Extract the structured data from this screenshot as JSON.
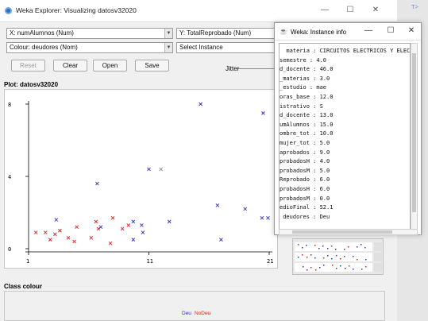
{
  "main_window": {
    "title": "Weka Explorer: Visualizing datosv32020",
    "minimize": "—",
    "maximize": "☐",
    "close": "✕"
  },
  "controls": {
    "x_axis": "X: numAlumnos (Num)",
    "y_axis": "Y: TotalReprobado (Num)",
    "colour": "Colour: deudores (Nom)",
    "select_instance": "Select Instance",
    "reset": "Reset",
    "clear": "Clear",
    "open": "Open",
    "save": "Save",
    "jitter": "Jitter"
  },
  "plot": {
    "label": "Plot: datosv32020",
    "y_ticks": [
      "8",
      "4",
      "0"
    ],
    "x_ticks": [
      "1",
      "11",
      "21"
    ]
  },
  "class_colour": {
    "label": "Class colour",
    "deu": "Deu",
    "nodeu": "NoDeu"
  },
  "colors": {
    "deu": "#3333cc",
    "nodeu": "#dd2222"
  },
  "right_stub": {
    "text": "T>"
  },
  "instance_info": {
    "title": "Weka: Instance info",
    "lines": [
      "  materia : CIRCUITOS ELECTRICOS Y ELECTRO",
      "semestre : 4.0",
      "d_docente : 46.0",
      "_materias : 3.0",
      "_estudio : mae",
      "oras_base : 12.0",
      "istrativo : S",
      "d_docente : 13.0",
      "umAlumnos : 15.0",
      "ombre_tot : 10.0",
      "mujer_tot : 5.0",
      "aprobados : 9.0",
      "probadosH : 4.0",
      "probadosM : 5.0",
      "Reprobado : 6.0",
      "probadosH : 6.0",
      "probadosM : 0.0",
      "edioFinal : 52.1",
      " deudores : Deu"
    ]
  },
  "chart_data": {
    "type": "scatter",
    "title": "",
    "xlabel": "numAlumnos",
    "ylabel": "TotalReprobado",
    "xlim": [
      1,
      21
    ],
    "ylim": [
      0,
      8
    ],
    "x_ticks": [
      1,
      11,
      21
    ],
    "y_ticks": [
      0,
      4,
      8
    ],
    "series": [
      {
        "name": "Deu",
        "color": "#3333cc",
        "points": [
          [
            15.3,
            8.0
          ],
          [
            20.5,
            7.5
          ],
          [
            6.7,
            3.6
          ],
          [
            11.0,
            4.4
          ],
          [
            16.7,
            2.4
          ],
          [
            19.0,
            2.2
          ],
          [
            20.4,
            1.7
          ],
          [
            20.9,
            1.7
          ],
          [
            3.3,
            1.6
          ],
          [
            12.7,
            1.5
          ],
          [
            9.7,
            1.5
          ],
          [
            10.4,
            1.3
          ],
          [
            7.0,
            1.2
          ],
          [
            10.5,
            0.9
          ],
          [
            17.0,
            0.5
          ],
          [
            9.7,
            0.5
          ]
        ]
      },
      {
        "name": "NoDeu",
        "color": "#dd2222",
        "points": [
          [
            1.6,
            0.9
          ],
          [
            2.4,
            0.9
          ],
          [
            3.2,
            0.8
          ],
          [
            3.6,
            1.0
          ],
          [
            4.3,
            0.6
          ],
          [
            5.0,
            1.2
          ],
          [
            6.2,
            0.6
          ],
          [
            6.6,
            1.5
          ],
          [
            6.8,
            1.1
          ],
          [
            7.8,
            0.3
          ],
          [
            8.0,
            1.7
          ],
          [
            8.8,
            1.1
          ],
          [
            9.3,
            1.3
          ],
          [
            4.8,
            0.4
          ],
          [
            2.8,
            0.5
          ]
        ]
      },
      {
        "name": "",
        "color": "#888888",
        "points": [
          [
            12.0,
            4.4
          ]
        ]
      }
    ]
  }
}
